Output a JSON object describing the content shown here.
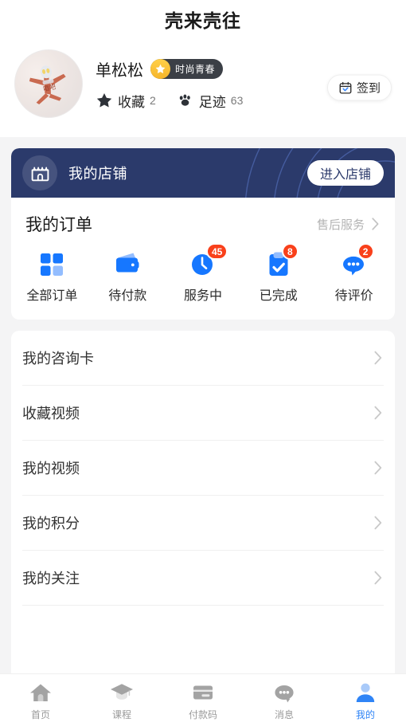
{
  "header": {
    "title": "壳来壳往"
  },
  "profile": {
    "avatar_name": "user-avatar",
    "username": "单松松",
    "vip_badge": "时尚青春",
    "stats": [
      {
        "icon": "star-icon",
        "label": "收藏",
        "value": "2"
      },
      {
        "icon": "paw-icon",
        "label": "足迹",
        "value": "63"
      }
    ],
    "signin_label": "签到",
    "signin_icon": "calendar-icon"
  },
  "store": {
    "icon": "shop-icon",
    "title": "我的店铺",
    "enter_label": "进入店铺"
  },
  "orders": {
    "title": "我的订单",
    "after_sales_label": "售后服务",
    "chevron": "chevron-right-icon",
    "statuses": [
      {
        "icon": "grid-icon",
        "label": "全部订单",
        "badge": ""
      },
      {
        "icon": "wallet-icon",
        "label": "待付款",
        "badge": ""
      },
      {
        "icon": "clock-icon",
        "label": "服务中",
        "badge": "45"
      },
      {
        "icon": "clipboard-check-icon",
        "label": "已完成",
        "badge": "8"
      },
      {
        "icon": "comment-icon",
        "label": "待评价",
        "badge": "2"
      }
    ]
  },
  "menu": {
    "items": [
      {
        "label": "我的咨询卡"
      },
      {
        "label": "收藏视频"
      },
      {
        "label": "我的视频"
      },
      {
        "label": "我的积分"
      },
      {
        "label": "我的关注"
      }
    ]
  },
  "tabbar": {
    "items": [
      {
        "icon": "home-icon",
        "label": "首页",
        "active": false
      },
      {
        "icon": "graduation-cap-icon",
        "label": "课程",
        "active": false
      },
      {
        "icon": "card-icon",
        "label": "付款码",
        "active": false
      },
      {
        "icon": "chat-icon",
        "label": "消息",
        "active": false
      },
      {
        "icon": "person-icon",
        "label": "我的",
        "active": true
      }
    ]
  },
  "colors": {
    "accent_blue": "#1677ff",
    "badge_red": "#f9401b",
    "banner_navy": "#2b3a6b",
    "vip_yellow": "#f6b52a",
    "tab_active": "#2f84f6",
    "page_bg": "#f4f4f5"
  }
}
